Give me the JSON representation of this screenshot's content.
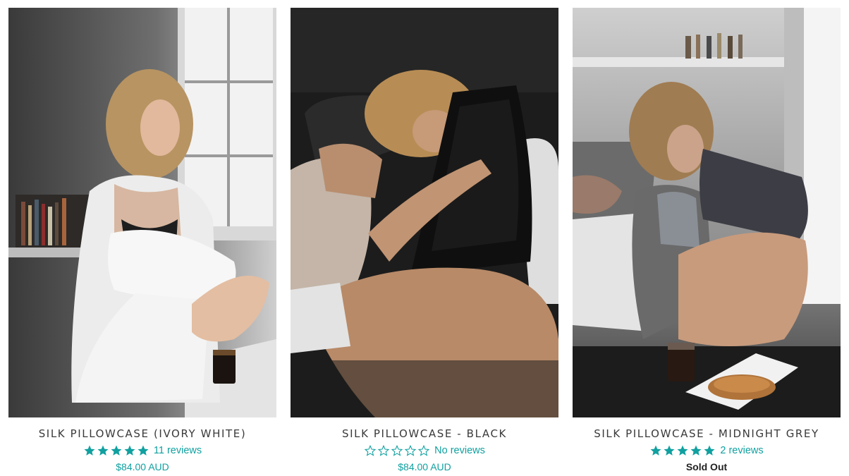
{
  "colors": {
    "accent": "#11a0a0",
    "title": "#3a3a3a",
    "sold_out": "#222222"
  },
  "products": [
    {
      "title": "SILK PILLOWCASE (IVORY WHITE)",
      "rating": 5,
      "reviews_label": "11 reviews",
      "price": "$84.00 AUD",
      "image_icon": "product-photo-ivory-white"
    },
    {
      "title": "SILK PILLOWCASE - BLACK",
      "rating": 0,
      "reviews_label": "No reviews",
      "price": "$84.00 AUD",
      "image_icon": "product-photo-black"
    },
    {
      "title": "SILK PILLOWCASE - MIDNIGHT GREY",
      "rating": 5,
      "reviews_label": "2 reviews",
      "price": "Sold Out",
      "image_icon": "product-photo-midnight-grey"
    }
  ]
}
